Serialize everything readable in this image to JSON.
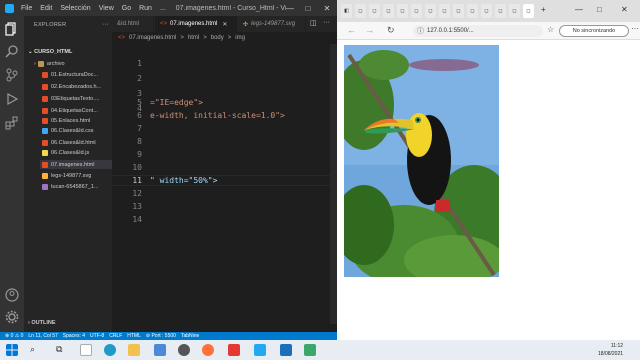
{
  "vscode": {
    "menu": [
      "File",
      "Edit",
      "Selección",
      "View",
      "Go",
      "Run",
      "..."
    ],
    "title": "07.imagenes.html - Curso_Html - Vis...",
    "sidebar": {
      "header": "EXPLORER",
      "project": "CURSO_HTML",
      "folder": "archivo",
      "files": [
        {
          "name": "01.EstructuraDoc...",
          "color": "#e44d26"
        },
        {
          "name": "02.Encabezados.h...",
          "color": "#e44d26"
        },
        {
          "name": "03EtiquetasTexto....",
          "color": "#e44d26"
        },
        {
          "name": "04.EtiquetasCont...",
          "color": "#e44d26"
        },
        {
          "name": "05.Enlaces.html",
          "color": "#e44d26"
        },
        {
          "name": "06.Clases&Id.css",
          "color": "#42a5f5"
        },
        {
          "name": "06.Clases&Id.html",
          "color": "#e44d26"
        },
        {
          "name": "06.Clases&Id.js",
          "color": "#f0db4f"
        },
        {
          "name": "07.imagenes.html",
          "color": "#e44d26"
        },
        {
          "name": "legs-149877.svg",
          "color": "#ffb13b"
        },
        {
          "name": "tucan-6545867_1...",
          "color": "#a074c4"
        }
      ],
      "outline": "OUTLINE"
    },
    "tabs": [
      {
        "label": "&Id.html",
        "active": false
      },
      {
        "label": "07.imagenes.html",
        "active": true
      },
      {
        "label": "legs-149877.svg",
        "active": false
      }
    ],
    "breadcrumb": [
      "07.imagenes.html",
      ">",
      "html",
      ">",
      "body",
      ">",
      "img"
    ],
    "lines": [
      {
        "num": "1",
        "code": ""
      },
      {
        "num": "2",
        "code": ""
      },
      {
        "num": "3",
        "code": ""
      },
      {
        "num": "4",
        "code": ""
      },
      {
        "num": "5",
        "code": "=\"IE=edge\">"
      },
      {
        "num": "6",
        "code": "e-width, initial-scale=1.0\">"
      },
      {
        "num": "7",
        "code": ""
      },
      {
        "num": "8",
        "code": ""
      },
      {
        "num": "9",
        "code": ""
      },
      {
        "num": "10",
        "code": ""
      },
      {
        "num": "11",
        "code": "\" width=\"50%\">"
      },
      {
        "num": "12",
        "code": ""
      },
      {
        "num": "13",
        "code": ""
      },
      {
        "num": "14",
        "code": ""
      }
    ],
    "status": [
      "⊗ 0 ⚠ 0",
      "Ln 11, Col 57",
      "Spaces: 4",
      "UTF-8",
      "CRLF",
      "HTML",
      "⊘ Port : 5500",
      "TabNine"
    ]
  },
  "browser": {
    "url": "127.0.0.1:5500/...",
    "sync_label": "No sincronizando",
    "image_alt": "tucan"
  },
  "taskbar": {
    "time": "11:12",
    "date": "18/08/2021"
  }
}
